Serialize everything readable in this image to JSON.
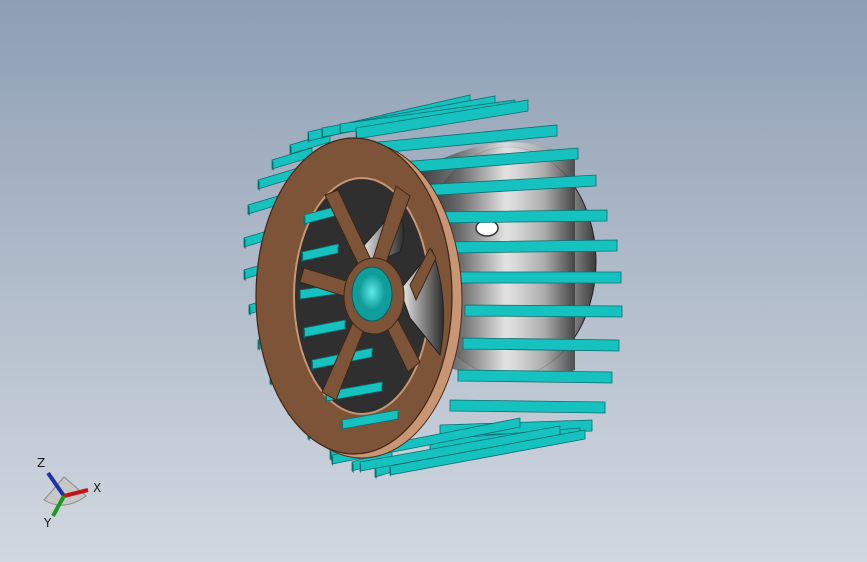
{
  "viewport": {
    "background_top": "#8d9fb4",
    "background_bottom": "#d1d8e1"
  },
  "model": {
    "name": "squirrel-cage-impeller",
    "colors": {
      "blade_face": "#16c2c0",
      "blade_top": "#7fe3df",
      "blade_dark": "#0a6e6e",
      "ring": "#7d5437",
      "ring_edge": "#c89575",
      "drum_light": "#e9e9e9",
      "drum_dark": "#3b3b3b"
    }
  },
  "triad": {
    "x_label": "X",
    "y_label": "Y",
    "z_label": "Z",
    "x_color": "#c0151b",
    "y_color": "#1b9a1b",
    "z_color": "#1c33a8"
  }
}
